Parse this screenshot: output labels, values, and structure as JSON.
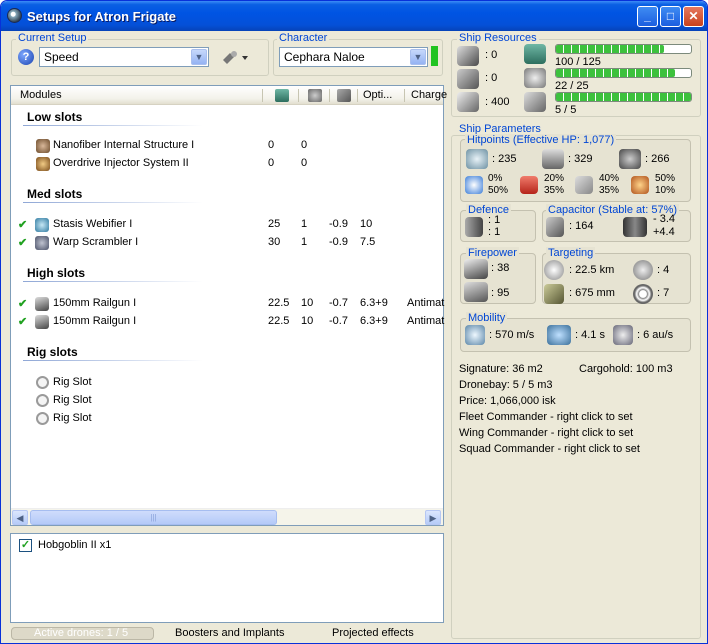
{
  "window": {
    "title": "Setups for Atron Frigate"
  },
  "current_setup": {
    "legend": "Current Setup",
    "value": "Speed"
  },
  "character": {
    "legend": "Character",
    "value": "Cephara Naloe"
  },
  "modules": {
    "columns": [
      "Modules",
      "Opti...",
      "Charge"
    ],
    "sections": [
      {
        "title": "Low slots",
        "items": [
          {
            "name": "Nanofiber Internal Structure I",
            "active": false,
            "c1": "0",
            "c2": "0",
            "c3": "",
            "c4": "",
            "charge": ""
          },
          {
            "name": "Overdrive Injector System II",
            "active": false,
            "c1": "0",
            "c2": "0",
            "c3": "",
            "c4": "",
            "charge": ""
          }
        ]
      },
      {
        "title": "Med slots",
        "items": [
          {
            "name": "Stasis Webifier I",
            "active": true,
            "c1": "25",
            "c2": "1",
            "c3": "-0.9",
            "c4": "10",
            "charge": ""
          },
          {
            "name": "Warp Scrambler I",
            "active": true,
            "c1": "30",
            "c2": "1",
            "c3": "-0.9",
            "c4": "7.5",
            "charge": ""
          }
        ]
      },
      {
        "title": "High slots",
        "items": [
          {
            "name": "150mm Railgun I",
            "active": true,
            "c1": "22.5",
            "c2": "10",
            "c3": "-0.7",
            "c4": "6.3+9",
            "charge": "Antimat"
          },
          {
            "name": "150mm Railgun I",
            "active": true,
            "c1": "22.5",
            "c2": "10",
            "c3": "-0.7",
            "c4": "6.3+9",
            "charge": "Antimat"
          }
        ]
      },
      {
        "title": "Rig slots",
        "items": [
          {
            "name": "Rig Slot"
          },
          {
            "name": "Rig Slot"
          },
          {
            "name": "Rig Slot"
          }
        ]
      }
    ]
  },
  "drones": {
    "item": "Hobgoblin II x1",
    "checked": true
  },
  "status_bar": {
    "active_drones": "Active drones: 1 / 5",
    "boosters": "Boosters and Implants",
    "projected": "Projected effects"
  },
  "ship_resources": {
    "legend": "Ship Resources",
    "left": [
      "0",
      "0",
      "400"
    ],
    "bars": [
      {
        "label": "100 / 125",
        "fraction": 0.8
      },
      {
        "label": "22 / 25",
        "fraction": 0.88
      },
      {
        "label": "5 / 5",
        "fraction": 1.0
      }
    ]
  },
  "ship_parameters": {
    "legend": "Ship Parameters",
    "hitpoints": {
      "legend": "Hitpoints (Effective HP: 1,077)",
      "shield": "235",
      "armor": "329",
      "structure": "266",
      "resists": [
        {
          "top": "0%",
          "bottom": "50%"
        },
        {
          "top": "20%",
          "bottom": "35%"
        },
        {
          "top": "40%",
          "bottom": "35%"
        },
        {
          "top": "50%",
          "bottom": "10%"
        }
      ]
    },
    "defence": {
      "legend": "Defence",
      "a": "1",
      "b": "1"
    },
    "capacitor": {
      "legend": "Capacitor (Stable at: 57%)",
      "value": "164",
      "top": "- 3.4",
      "bottom": "+4.4"
    },
    "firepower": {
      "legend": "Firepower",
      "turret": "38",
      "missile": "95"
    },
    "targeting": {
      "legend": "Targeting",
      "range": "22.5 km",
      "targets": "4",
      "scan": "675 mm",
      "sensor": "7"
    },
    "mobility": {
      "legend": "Mobility",
      "speed": "570 m/s",
      "align": "4.1 s",
      "warp": "6 au/s"
    },
    "signature": "Signature: 36 m2",
    "cargohold": "Cargohold: 100 m3",
    "dronebay": "Dronebay: 5 / 5 m3",
    "price": "Price: 1,066,000 isk",
    "fleet": "Fleet Commander - right click to set",
    "wing": "Wing Commander - right click to set",
    "squad": "Squad Commander - right click to set"
  }
}
